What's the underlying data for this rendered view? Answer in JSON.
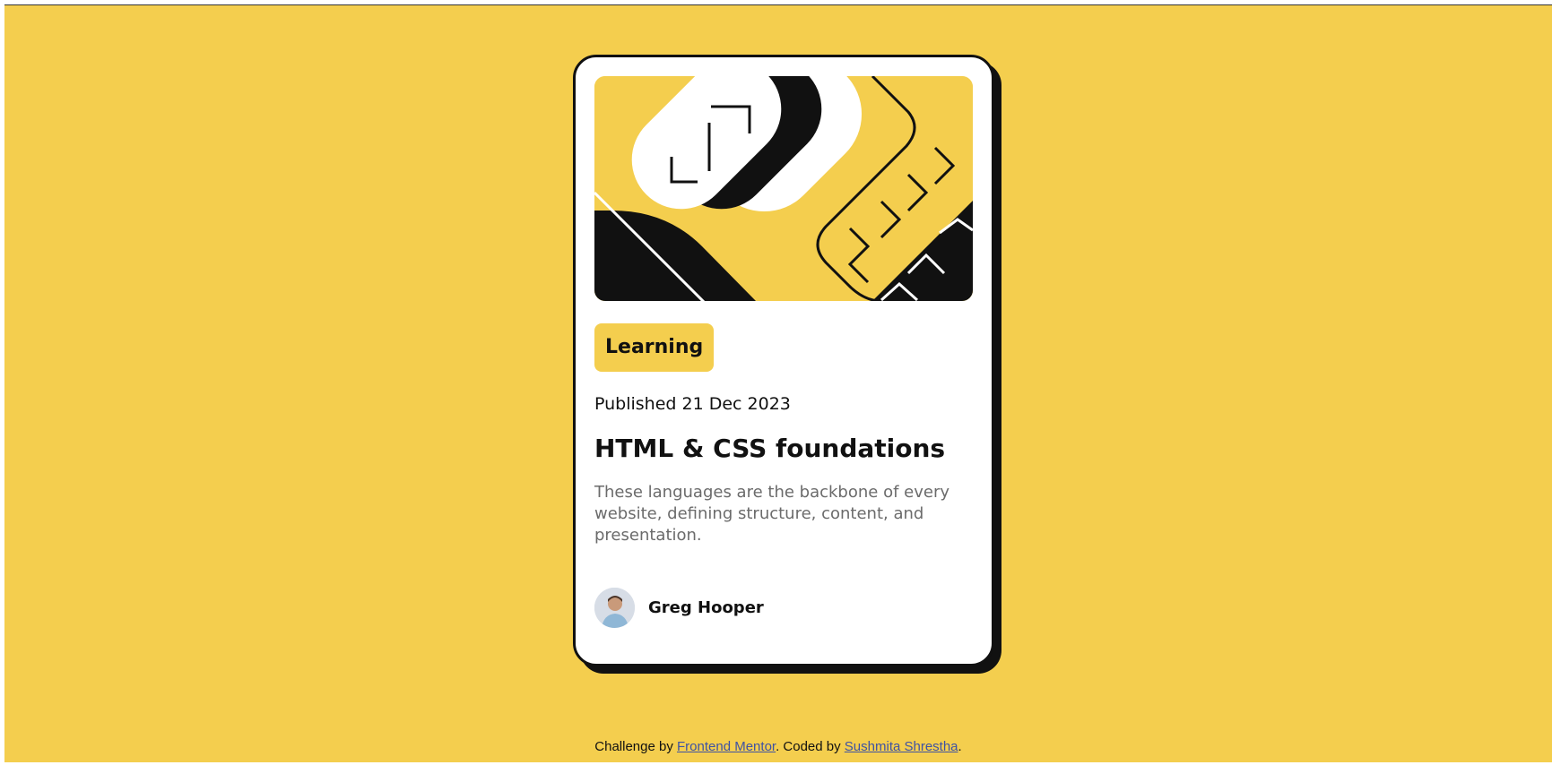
{
  "card": {
    "tag": "Learning",
    "published": "Published 21 Dec 2023",
    "title": "HTML & CSS foundations",
    "description": "These languages are the backbone of every website, defining structure, content, and presentation.",
    "author": "Greg Hooper"
  },
  "footer": {
    "prefix": "Challenge by ",
    "link1": "Frontend Mentor",
    "middle": ". Coded by ",
    "link2": "Sushmita Shrestha",
    "suffix": "."
  },
  "colors": {
    "background": "#F4CE4E",
    "card": "#FFFFFF",
    "ink": "#111111",
    "muted": "#6B6B6B",
    "link": "#3E52A3"
  },
  "icons": {
    "hero": "illustration-article",
    "avatar": "avatar-photo"
  }
}
